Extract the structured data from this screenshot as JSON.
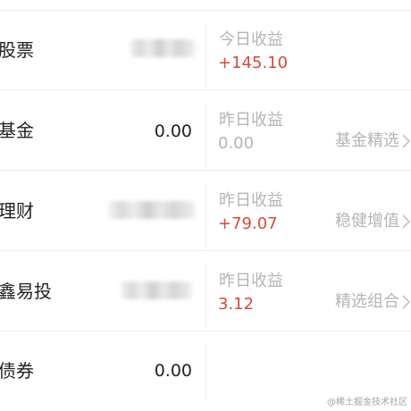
{
  "rows": [
    {
      "name": "股票",
      "amount": "",
      "income_label": "今日收益",
      "income_value": "+145.10",
      "promo": ""
    },
    {
      "name": "基金",
      "amount": "0.00",
      "income_label": "昨日收益",
      "income_value": "0.00",
      "promo": "基金精选"
    },
    {
      "name": "理财",
      "amount": "",
      "income_label": "昨日收益",
      "income_value": "+79.07",
      "promo": "稳健增值"
    },
    {
      "name": "鑫易投",
      "amount": "",
      "income_label": "昨日收益",
      "income_value": "3.12",
      "promo": "精选组合"
    },
    {
      "name": "债券",
      "amount": "0.00",
      "income_label": "",
      "income_value": "",
      "promo": ""
    }
  ],
  "colors": {
    "positive": "#d44b3d",
    "muted": "#b5b5b5",
    "text": "#222222",
    "divider": "#ececec"
  },
  "watermark": "@稀土掘金技术社区"
}
